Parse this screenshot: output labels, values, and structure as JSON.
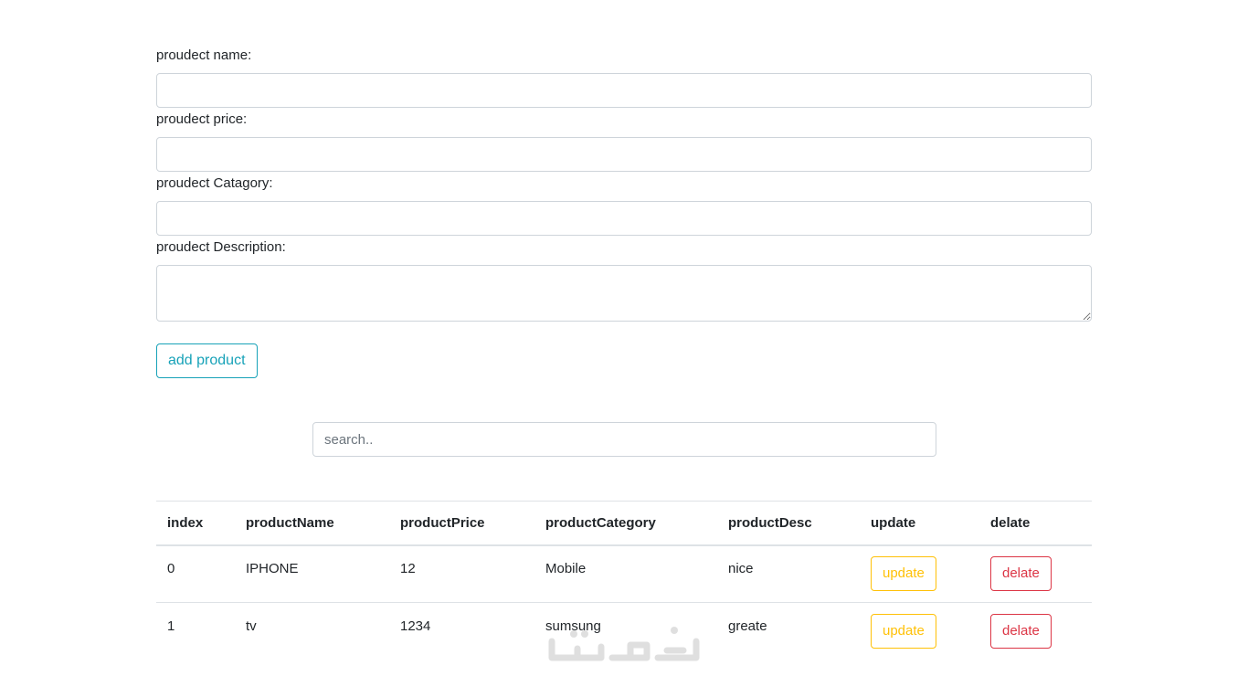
{
  "form": {
    "name_label": "proudect name:",
    "name_value": "",
    "price_label": "proudect price:",
    "price_value": "",
    "category_label": "proudect Catagory:",
    "category_value": "",
    "description_label": "proudect Description:",
    "description_value": "",
    "add_button": "add product"
  },
  "search": {
    "placeholder": "search..",
    "value": ""
  },
  "table": {
    "headers": [
      "index",
      "productName",
      "productPrice",
      "productCategory",
      "productDesc",
      "update",
      "delate"
    ],
    "rows": [
      {
        "index": "0",
        "name": "IPHONE",
        "price": "12",
        "category": "Mobile",
        "desc": "nice",
        "update_label": "update",
        "delete_label": "delate"
      },
      {
        "index": "1",
        "name": "tv",
        "price": "1234",
        "category": "sumsung",
        "desc": "greate",
        "update_label": "update",
        "delete_label": "delate"
      }
    ]
  },
  "colors": {
    "info": "#17a2b8",
    "warning": "#ffc107",
    "danger": "#dc3545",
    "border": "#ced4da"
  },
  "watermark_icon": "khamsat-logo-watermark"
}
